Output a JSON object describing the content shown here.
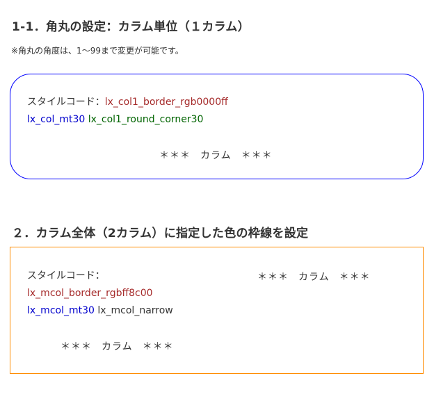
{
  "section1": {
    "heading": "1-1．角丸の設定：カラム単位（１カラム）",
    "note": "※角丸の角度は、1～99まで変更が可能です。",
    "box": {
      "border_color": "#0000ff",
      "label": "スタイルコード：",
      "class_border": "lx_col1_border_rgb0000ff",
      "class_margin": "lx_col_mt30",
      "class_round": "lx_col1_round_corner30",
      "stars_left": "＊＊＊",
      "column_label": "カラム",
      "stars_right": "＊＊＊"
    }
  },
  "section2": {
    "heading": "２．カラム全体（2カラム）に指定した色の枠線を設定",
    "box": {
      "border_color": "#ff8c00",
      "label": "スタイルコード：",
      "class_border": "lx_mcol_border_rgbff8c00",
      "class_margin": "lx_mcol_mt30",
      "class_narrow": "lx_mcol_narrow",
      "left_column": {
        "stars_left": "＊＊＊",
        "column_label": "カラム",
        "stars_right": "＊＊＊"
      },
      "right_column": {
        "stars_left": "＊＊＊",
        "column_label": "カラム",
        "stars_right": "＊＊＊"
      }
    }
  }
}
